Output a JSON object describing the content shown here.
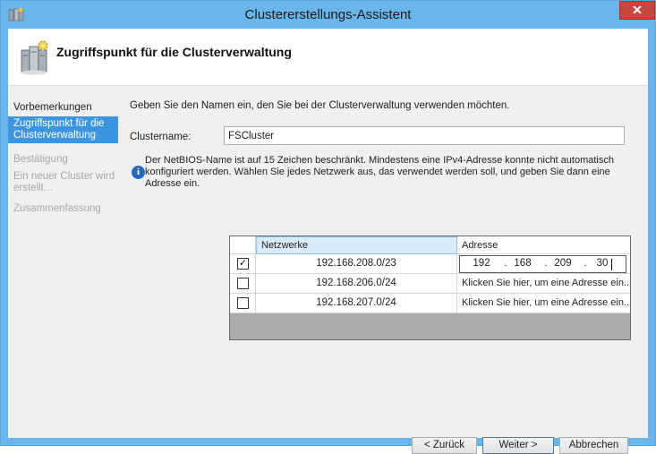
{
  "window": {
    "title": "Clustererstellungs-Assistent",
    "close_glyph": "✕"
  },
  "header": {
    "title": "Zugriffspunkt für die Clusterverwaltung",
    "icon": "cluster-servers-icon"
  },
  "nav": {
    "items": [
      {
        "label": "Vorbemerkungen",
        "state": "done"
      },
      {
        "label": "Zugriffspunkt für die Clusterverwaltung",
        "state": "active"
      },
      {
        "label": "Bestätigung",
        "state": "disabled"
      },
      {
        "label": "Ein neuer Cluster wird erstellt...",
        "state": "disabled"
      },
      {
        "label": "Zusammenfassung",
        "state": "disabled"
      }
    ]
  },
  "main": {
    "intro": "Geben Sie den Namen ein, den Sie bei der Clusterverwaltung verwenden möchten.",
    "cluster_name_label": "Clustername:",
    "cluster_name_value": "FSCluster",
    "info_text": "Der NetBIOS-Name ist auf 15 Zeichen beschränkt.  Mindestens eine IPv4-Adresse konnte nicht automatisch konfiguriert werden. Wählen Sie jedes Netzwerk aus, das verwendet werden soll, und geben Sie dann eine Adresse ein.",
    "grid": {
      "col_network": "Netzwerke",
      "col_address": "Adresse",
      "rows": [
        {
          "checked": true,
          "network": "192.168.208.0/23",
          "address_octets": [
            "192",
            "168",
            "209",
            "30"
          ]
        },
        {
          "checked": false,
          "network": "192.168.206.0/24",
          "address": "Klicken Sie hier, um eine Adresse ein..."
        },
        {
          "checked": false,
          "network": "192.168.207.0/24",
          "address": "Klicken Sie hier, um eine Adresse ein..."
        }
      ]
    }
  },
  "buttons": {
    "back": "< Zurück",
    "next": "Weiter >",
    "cancel": "Abbrechen"
  },
  "colors": {
    "title_bar": "#6ab6ea",
    "nav_active": "#3d95e0",
    "close_button": "#c7473d"
  }
}
